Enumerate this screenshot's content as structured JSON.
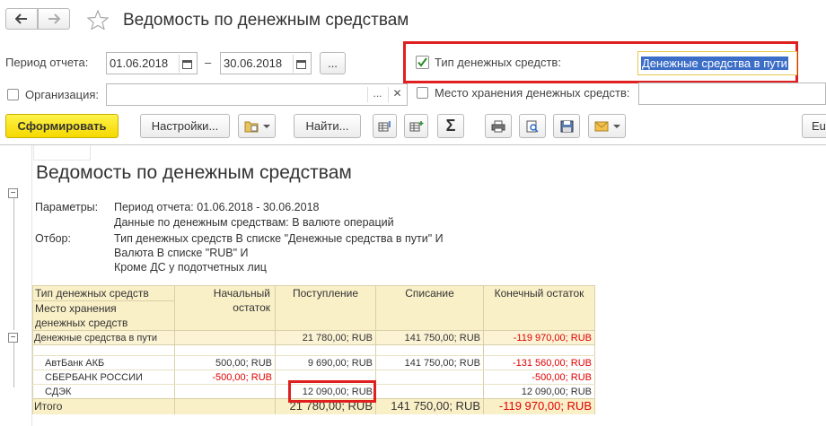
{
  "title": "Ведомость по денежным средствам",
  "params": {
    "period_label": "Период отчета:",
    "date_from": "01.06.2018",
    "date_to": "30.06.2018",
    "dash": "–",
    "ellipsis_btn": "...",
    "org_label": "Организация:",
    "type_label": "Тип денежных средств:",
    "type_value": "Денежные средства в пути",
    "place_label": "Место хранения денежных средств:"
  },
  "toolbar": {
    "generate": "Сформировать",
    "settings": "Настройки...",
    "find": "Найти...",
    "sum": "Σ",
    "more": "Eu"
  },
  "report": {
    "title": "Ведомость по денежным средствам",
    "params_label": "Параметры:",
    "period_line": "Период отчета: 01.06.2018 - 30.06.2018",
    "data_line": "Данные по денежным средствам: В валюте операций",
    "filter_label": "Отбор:",
    "filter_lines": [
      "Тип денежных средств В списке \"Денежные средства в пути\" И",
      "Валюта В списке \"RUB\" И",
      "Кроме ДС у подотчетных лиц"
    ],
    "headers": {
      "col1_a": "Тип денежных средств",
      "col1_b": "Место хранения",
      "col1_c": "денежных средств",
      "col2_a": "Начальный",
      "col2_b": "остаток",
      "col3": "Поступление",
      "col4": "Списание",
      "col5": "Конечный остаток"
    },
    "group": {
      "name": "Денежные средства в пути",
      "start": "",
      "income": "21 780,00; RUB",
      "expense": "141 750,00; RUB",
      "end": "-119 970,00; RUB"
    },
    "rows": [
      {
        "name": "АвтБанк АКБ",
        "start": "500,00; RUB",
        "income": "9 690,00; RUB",
        "expense": "141 750,00; RUB",
        "end": "-131 560,00; RUB"
      },
      {
        "name": "СБЕРБАНК РОССИИ",
        "start": "-500,00; RUB",
        "income": "",
        "expense": "",
        "end": "-500,00; RUB"
      },
      {
        "name": "СДЭК",
        "start": "",
        "income": "12 090,00; RUB",
        "expense": "",
        "end": "12 090,00; RUB"
      }
    ],
    "total": {
      "name": "Итого",
      "start": "",
      "income": "21 780,00; RUB",
      "expense": "141 750,00; RUB",
      "end": "-119 970,00; RUB"
    }
  }
}
